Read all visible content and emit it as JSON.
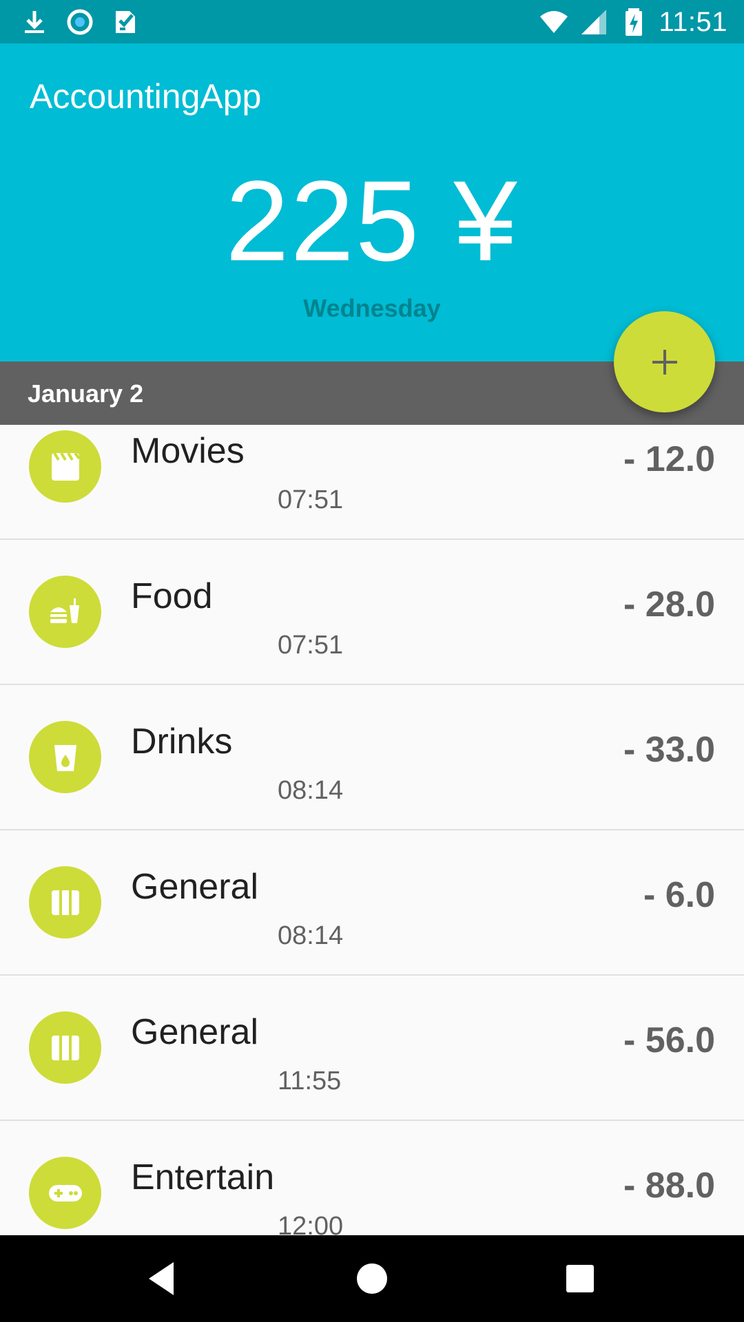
{
  "status_bar": {
    "time": "11:51",
    "left_icons": [
      "download-icon",
      "record-icon",
      "checklist-icon"
    ],
    "right_icons": [
      "wifi-icon",
      "signal-icon",
      "battery-charging-icon"
    ]
  },
  "app": {
    "title": "AccountingApp",
    "total_amount": "225 ¥",
    "day": "Wednesday"
  },
  "date_band": {
    "label": "January 2"
  },
  "fab": {
    "icon": "add-icon"
  },
  "entries": [
    {
      "category": "Movies",
      "time": "07:51",
      "amount": "- 12.0",
      "icon": "movie-icon"
    },
    {
      "category": "Food",
      "time": "07:51",
      "amount": "- 28.0",
      "icon": "food-icon"
    },
    {
      "category": "Drinks",
      "time": "08:14",
      "amount": "- 33.0",
      "icon": "drink-icon"
    },
    {
      "category": "General",
      "time": "08:14",
      "amount": "- 6.0",
      "icon": "general-icon"
    },
    {
      "category": "General",
      "time": "11:55",
      "amount": "- 56.0",
      "icon": "general-icon"
    },
    {
      "category": "Entertain",
      "time": "12:00",
      "amount": "- 88.0",
      "icon": "gamepad-icon"
    }
  ],
  "nav_bar": {
    "buttons": [
      "back-icon",
      "home-icon",
      "recents-icon"
    ]
  },
  "colors": {
    "status_bar": "#0097a7",
    "header": "#00bcd4",
    "accent": "#cddc39",
    "date_band": "#616161"
  }
}
